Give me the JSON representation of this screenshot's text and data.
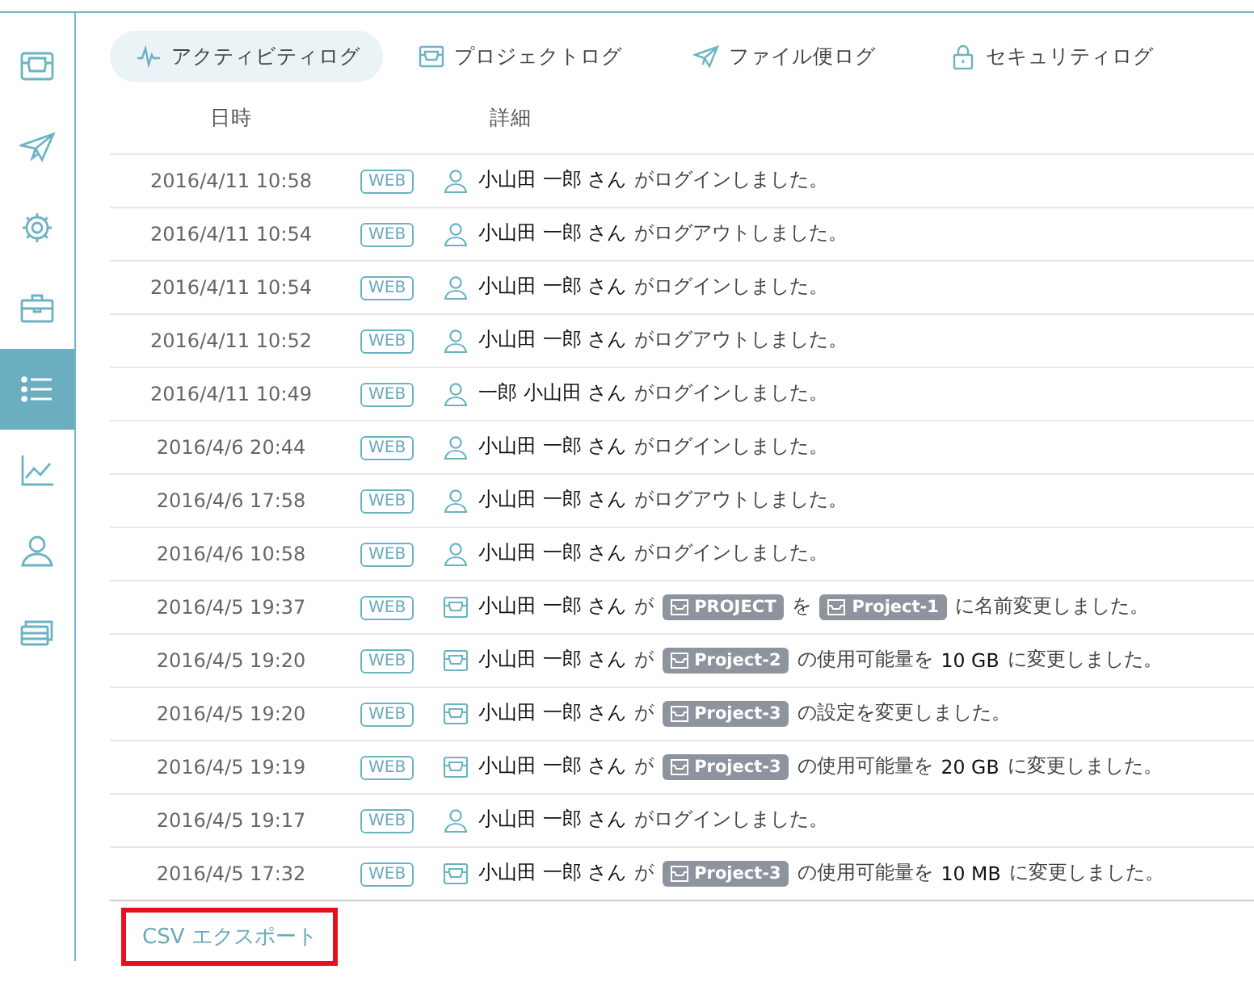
{
  "sidebar": {
    "items": [
      {
        "selected": false
      },
      {
        "selected": false
      },
      {
        "selected": false
      },
      {
        "selected": false
      },
      {
        "selected": true
      },
      {
        "selected": false
      },
      {
        "selected": false
      },
      {
        "selected": false
      }
    ]
  },
  "tabs": [
    {
      "label": "アクティビティログ",
      "selected": true
    },
    {
      "label": "プロジェクトログ",
      "selected": false
    },
    {
      "label": "ファイル便ログ",
      "selected": false
    },
    {
      "label": "セキュリティログ",
      "selected": false
    }
  ],
  "table": {
    "columns": [
      "日時",
      "詳細"
    ],
    "rows": [
      {
        "date": "2016/4/11 10:58",
        "source": "WEB",
        "kind": "user",
        "parts": [
          {
            "kind": "em",
            "text": "小山田 一郎 さん"
          },
          {
            "kind": "text",
            "text": "がログインしました。"
          }
        ]
      },
      {
        "date": "2016/4/11 10:54",
        "source": "WEB",
        "kind": "user",
        "parts": [
          {
            "kind": "em",
            "text": "小山田 一郎 さん"
          },
          {
            "kind": "text",
            "text": "がログアウトしました。"
          }
        ]
      },
      {
        "date": "2016/4/11 10:54",
        "source": "WEB",
        "kind": "user",
        "parts": [
          {
            "kind": "em",
            "text": "小山田 一郎 さん"
          },
          {
            "kind": "text",
            "text": "がログインしました。"
          }
        ]
      },
      {
        "date": "2016/4/11 10:52",
        "source": "WEB",
        "kind": "user",
        "parts": [
          {
            "kind": "em",
            "text": "小山田 一郎 さん"
          },
          {
            "kind": "text",
            "text": "がログアウトしました。"
          }
        ]
      },
      {
        "date": "2016/4/11 10:49",
        "source": "WEB",
        "kind": "user",
        "parts": [
          {
            "kind": "em",
            "text": "一郎 小山田 さん"
          },
          {
            "kind": "text",
            "text": "がログインしました。"
          }
        ]
      },
      {
        "date": "2016/4/6 20:44",
        "source": "WEB",
        "kind": "user",
        "parts": [
          {
            "kind": "em",
            "text": "小山田 一郎 さん"
          },
          {
            "kind": "text",
            "text": "がログインしました。"
          }
        ]
      },
      {
        "date": "2016/4/6 17:58",
        "source": "WEB",
        "kind": "user",
        "parts": [
          {
            "kind": "em",
            "text": "小山田 一郎 さん"
          },
          {
            "kind": "text",
            "text": "がログアウトしました。"
          }
        ]
      },
      {
        "date": "2016/4/6 10:58",
        "source": "WEB",
        "kind": "user",
        "parts": [
          {
            "kind": "em",
            "text": "小山田 一郎 さん"
          },
          {
            "kind": "text",
            "text": "がログインしました。"
          }
        ]
      },
      {
        "date": "2016/4/5 19:37",
        "source": "WEB",
        "kind": "project",
        "parts": [
          {
            "kind": "em",
            "text": "小山田 一郎 さん"
          },
          {
            "kind": "text",
            "text": "が"
          },
          {
            "kind": "tag",
            "text": "PROJECT"
          },
          {
            "kind": "text",
            "text": "を"
          },
          {
            "kind": "tag",
            "text": "Project-1"
          },
          {
            "kind": "text",
            "text": "に名前変更しました。"
          }
        ]
      },
      {
        "date": "2016/4/5 19:20",
        "source": "WEB",
        "kind": "project",
        "parts": [
          {
            "kind": "em",
            "text": "小山田 一郎 さん"
          },
          {
            "kind": "text",
            "text": "が"
          },
          {
            "kind": "tag",
            "text": "Project-2"
          },
          {
            "kind": "text",
            "text": "の使用可能量を"
          },
          {
            "kind": "em",
            "text": "10 GB"
          },
          {
            "kind": "text",
            "text": "に変更しました。"
          }
        ]
      },
      {
        "date": "2016/4/5 19:20",
        "source": "WEB",
        "kind": "project",
        "parts": [
          {
            "kind": "em",
            "text": "小山田 一郎 さん"
          },
          {
            "kind": "text",
            "text": "が"
          },
          {
            "kind": "tag",
            "text": "Project-3"
          },
          {
            "kind": "text",
            "text": "の設定を変更しました。"
          }
        ]
      },
      {
        "date": "2016/4/5 19:19",
        "source": "WEB",
        "kind": "project",
        "parts": [
          {
            "kind": "em",
            "text": "小山田 一郎 さん"
          },
          {
            "kind": "text",
            "text": "が"
          },
          {
            "kind": "tag",
            "text": "Project-3"
          },
          {
            "kind": "text",
            "text": "の使用可能量を"
          },
          {
            "kind": "em",
            "text": "20 GB"
          },
          {
            "kind": "text",
            "text": "に変更しました。"
          }
        ]
      },
      {
        "date": "2016/4/5 19:17",
        "source": "WEB",
        "kind": "user",
        "parts": [
          {
            "kind": "em",
            "text": "小山田 一郎 さん"
          },
          {
            "kind": "text",
            "text": "がログインしました。"
          }
        ]
      },
      {
        "date": "2016/4/5 17:32",
        "source": "WEB",
        "kind": "project",
        "parts": [
          {
            "kind": "em",
            "text": "小山田 一郎 さん"
          },
          {
            "kind": "text",
            "text": "が"
          },
          {
            "kind": "tag",
            "text": "Project-3"
          },
          {
            "kind": "text",
            "text": "の使用可能量を"
          },
          {
            "kind": "em",
            "text": "10 MB"
          },
          {
            "kind": "text",
            "text": "に変更しました。"
          }
        ]
      }
    ]
  },
  "export": {
    "label": "CSV エクスポート",
    "highlighted": true
  }
}
